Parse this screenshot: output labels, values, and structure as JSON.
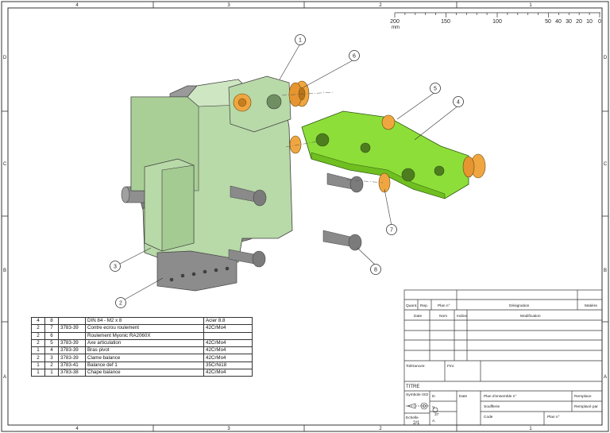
{
  "drawing": {
    "border_columns": [
      "4",
      "3",
      "2",
      "1"
    ],
    "border_rows": [
      "D",
      "C",
      "B",
      "A"
    ],
    "scale_ruler": {
      "unit": "mm",
      "ticks": [
        "200",
        "150",
        "100",
        "50",
        "40",
        "30",
        "20",
        "10",
        "0"
      ]
    },
    "balloons": [
      "1",
      "6",
      "5",
      "4",
      "3",
      "2",
      "7",
      "8"
    ],
    "parts_list": [
      {
        "qty": "4",
        "rep": "8",
        "plan": "",
        "designation": "DIN 84 - M2 x 8",
        "material": "Acier 8.8"
      },
      {
        "qty": "2",
        "rep": "7",
        "plan": "3783-39",
        "designation": "Contre ecrou roulement",
        "material": "42CrMo4"
      },
      {
        "qty": "2",
        "rep": "6",
        "plan": "",
        "designation": "Roulement Myonic RA2060X",
        "material": ""
      },
      {
        "qty": "2",
        "rep": "5",
        "plan": "3783-39",
        "designation": "Axe articulation",
        "material": "42CrMo4"
      },
      {
        "qty": "1",
        "rep": "4",
        "plan": "3783-39",
        "designation": "Bras pivot",
        "material": "42CrMo4"
      },
      {
        "qty": "2",
        "rep": "3",
        "plan": "3783-39",
        "designation": "Clame balance",
        "material": "42CrMo4"
      },
      {
        "qty": "1",
        "rep": "2",
        "plan": "3783-41",
        "designation": "Balance def 1",
        "material": "35CrNi18"
      },
      {
        "qty": "1",
        "rep": "1",
        "plan": "3783-38",
        "designation": "Chape balance",
        "material": "42CrMo4"
      }
    ],
    "title_block": {
      "header": {
        "quant": "Quant.",
        "rep": "Rep.",
        "plan": "Plan n°",
        "designation": "Désignation",
        "matiere": "Matière"
      },
      "revision": {
        "date": "Date",
        "nom": "Nom",
        "indice": "Indice",
        "modification": "Modification"
      },
      "tolerances": "Tolérances:",
      "fini": "Fini:",
      "titre": "TITRE",
      "symbole_iso": "Symbole ISO",
      "d_label": "D.",
      "v_label": "V.",
      "v_value": "37",
      "a_label": "A.",
      "date_label": "Date",
      "plan_ensemble": "Plan d'ensemble n°",
      "soufflerie": "Soufflerie",
      "remplace": "Remplace",
      "remplace_par": "Remplacé par",
      "code": "Code",
      "plan_no": "Plan n°",
      "echelle": "Echelle",
      "echelle_value": "2/1"
    }
  },
  "colors": {
    "frame": "#333333",
    "part_green_light": "#b8d9a8",
    "part_green_bright": "#8ede3a",
    "part_grey": "#8a8a8a",
    "part_orange": "#f0a640"
  }
}
